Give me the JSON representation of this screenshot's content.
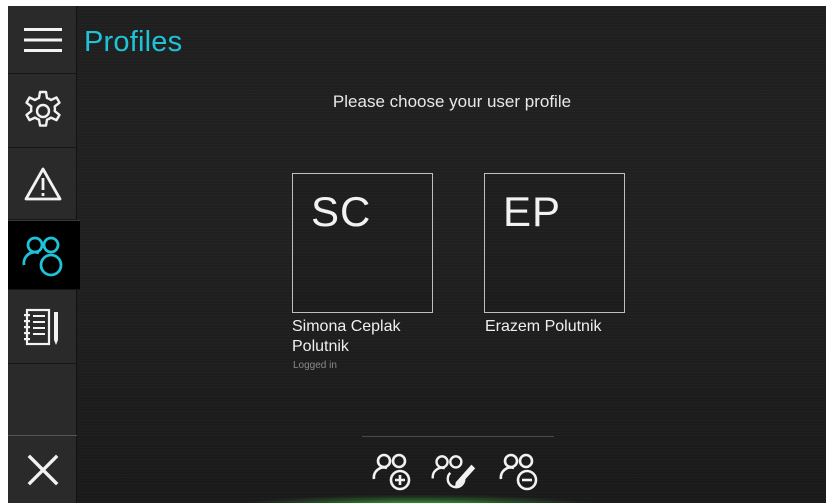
{
  "header": {
    "title": "Profiles"
  },
  "main": {
    "prompt": "Please choose your user profile",
    "profiles": [
      {
        "initials": "SC",
        "name": "Simona Ceplak Polutnik",
        "status": "Logged in"
      },
      {
        "initials": "EP",
        "name": "Erazem Polutnik",
        "status": ""
      }
    ]
  },
  "sidebar": {
    "items": [
      {
        "icon": "menu-icon"
      },
      {
        "icon": "gear-icon"
      },
      {
        "icon": "warning-icon"
      },
      {
        "icon": "users-icon",
        "active": true
      },
      {
        "icon": "notebook-icon"
      },
      {
        "icon": "close-icon"
      }
    ]
  },
  "toolbar": {
    "icons": [
      "add-user-icon",
      "edit-user-icon",
      "remove-user-icon"
    ]
  },
  "colors": {
    "accent": "#1fc3d8",
    "background": "#1f1f1f",
    "sidebar": "#2a2a2a",
    "glow": "#5ae65a"
  }
}
